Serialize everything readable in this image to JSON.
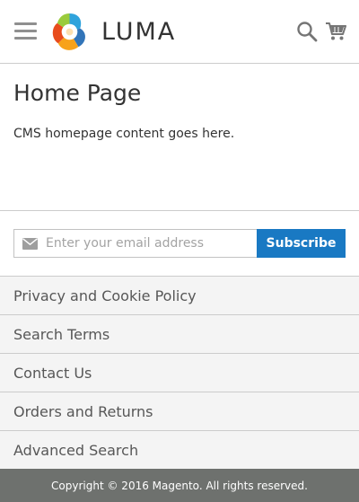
{
  "header": {
    "logo_text": "LUMA",
    "menu_icon": "hamburger-icon",
    "search_icon": "search-icon",
    "cart_icon": "cart-icon"
  },
  "main": {
    "title": "Home Page",
    "content": "CMS homepage content goes here."
  },
  "newsletter": {
    "placeholder": "Enter your email address",
    "value": "",
    "button_label": "Subscribe",
    "icon": "envelope-icon"
  },
  "footer": {
    "links": [
      "Privacy and Cookie Policy",
      "Search Terms",
      "Contact Us",
      "Orders and Returns",
      "Advanced Search"
    ],
    "copyright": "Copyright © 2016 Magento. All rights reserved."
  },
  "colors": {
    "accent": "#1979c3",
    "footer_bg": "#f4f4f4",
    "copyright_bg": "#6e716e"
  }
}
